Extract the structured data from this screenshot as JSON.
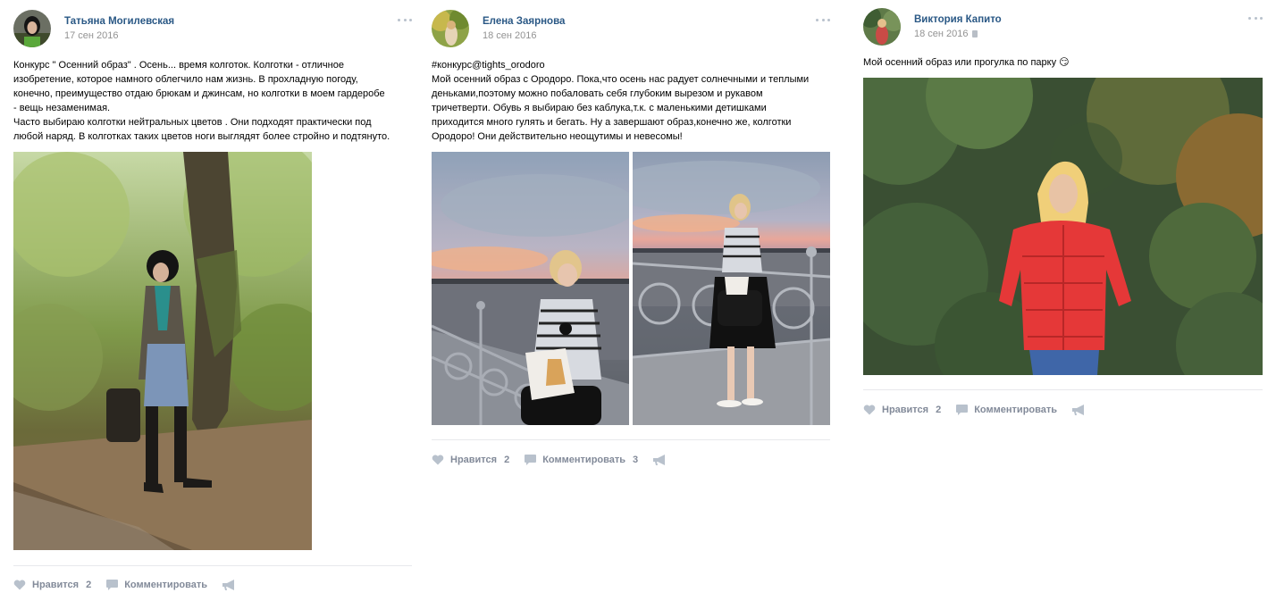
{
  "posts": [
    {
      "author": "Татьяна Могилевская",
      "date": "17 сен 2016",
      "text_lines": [
        "Конкурс \" Осенний образ\" . Осень... время колготок. Колготки - отличное",
        "изобретение, которое намного облегчило нам жизнь. В прохладную погоду,",
        "конечно, преимущество отдаю брюкам и джинсам, но колготки в моем гардеробе",
        "- вещь незаменимая.",
        "Часто выбираю колготки нейтральных цветов . Они подходят практически под",
        "любой наряд. В колготках таких цветов ноги выглядят более стройно и подтянуто."
      ],
      "like_label": "Нравится",
      "like_count": "2",
      "comment_label": "Комментировать",
      "comment_count": ""
    },
    {
      "author": "Елена Заярнова",
      "date": "18 сен 2016",
      "text_lines": [
        "#конкурс@tights_orodoro",
        "Мой осенний образ с Ородоро. Пока,что осень нас радует солнечными и теплыми",
        "деньками,поэтому можно побаловать себя глубоким вырезом и рукавом",
        "тричетверти. Обувь я выбираю без каблука,т.к. с маленькими детишками",
        "приходится много гулять и бегать. Ну а завершают образ,конечно же, колготки",
        "Ородоро! Они действительно неощутимы и невесомы!"
      ],
      "like_label": "Нравится",
      "like_count": "2",
      "comment_label": "Комментировать",
      "comment_count": "3"
    },
    {
      "author": "Виктория Капито",
      "date": "18 сен 2016",
      "text_lines": [
        "Мой осенний образ или прогулка по парку 😏"
      ],
      "like_label": "Нравится",
      "like_count": "2",
      "comment_label": "Комментировать",
      "comment_count": ""
    }
  ],
  "icons": {
    "like": "heart-icon",
    "comment": "comment-icon",
    "share": "share-icon",
    "more": "more-icon",
    "privacy": "lock-icon"
  },
  "colors": {
    "author": "#2a5885",
    "date": "#939393",
    "action": "#828a99",
    "icon": "#b8c1cc",
    "divider": "#e7e8ec"
  }
}
